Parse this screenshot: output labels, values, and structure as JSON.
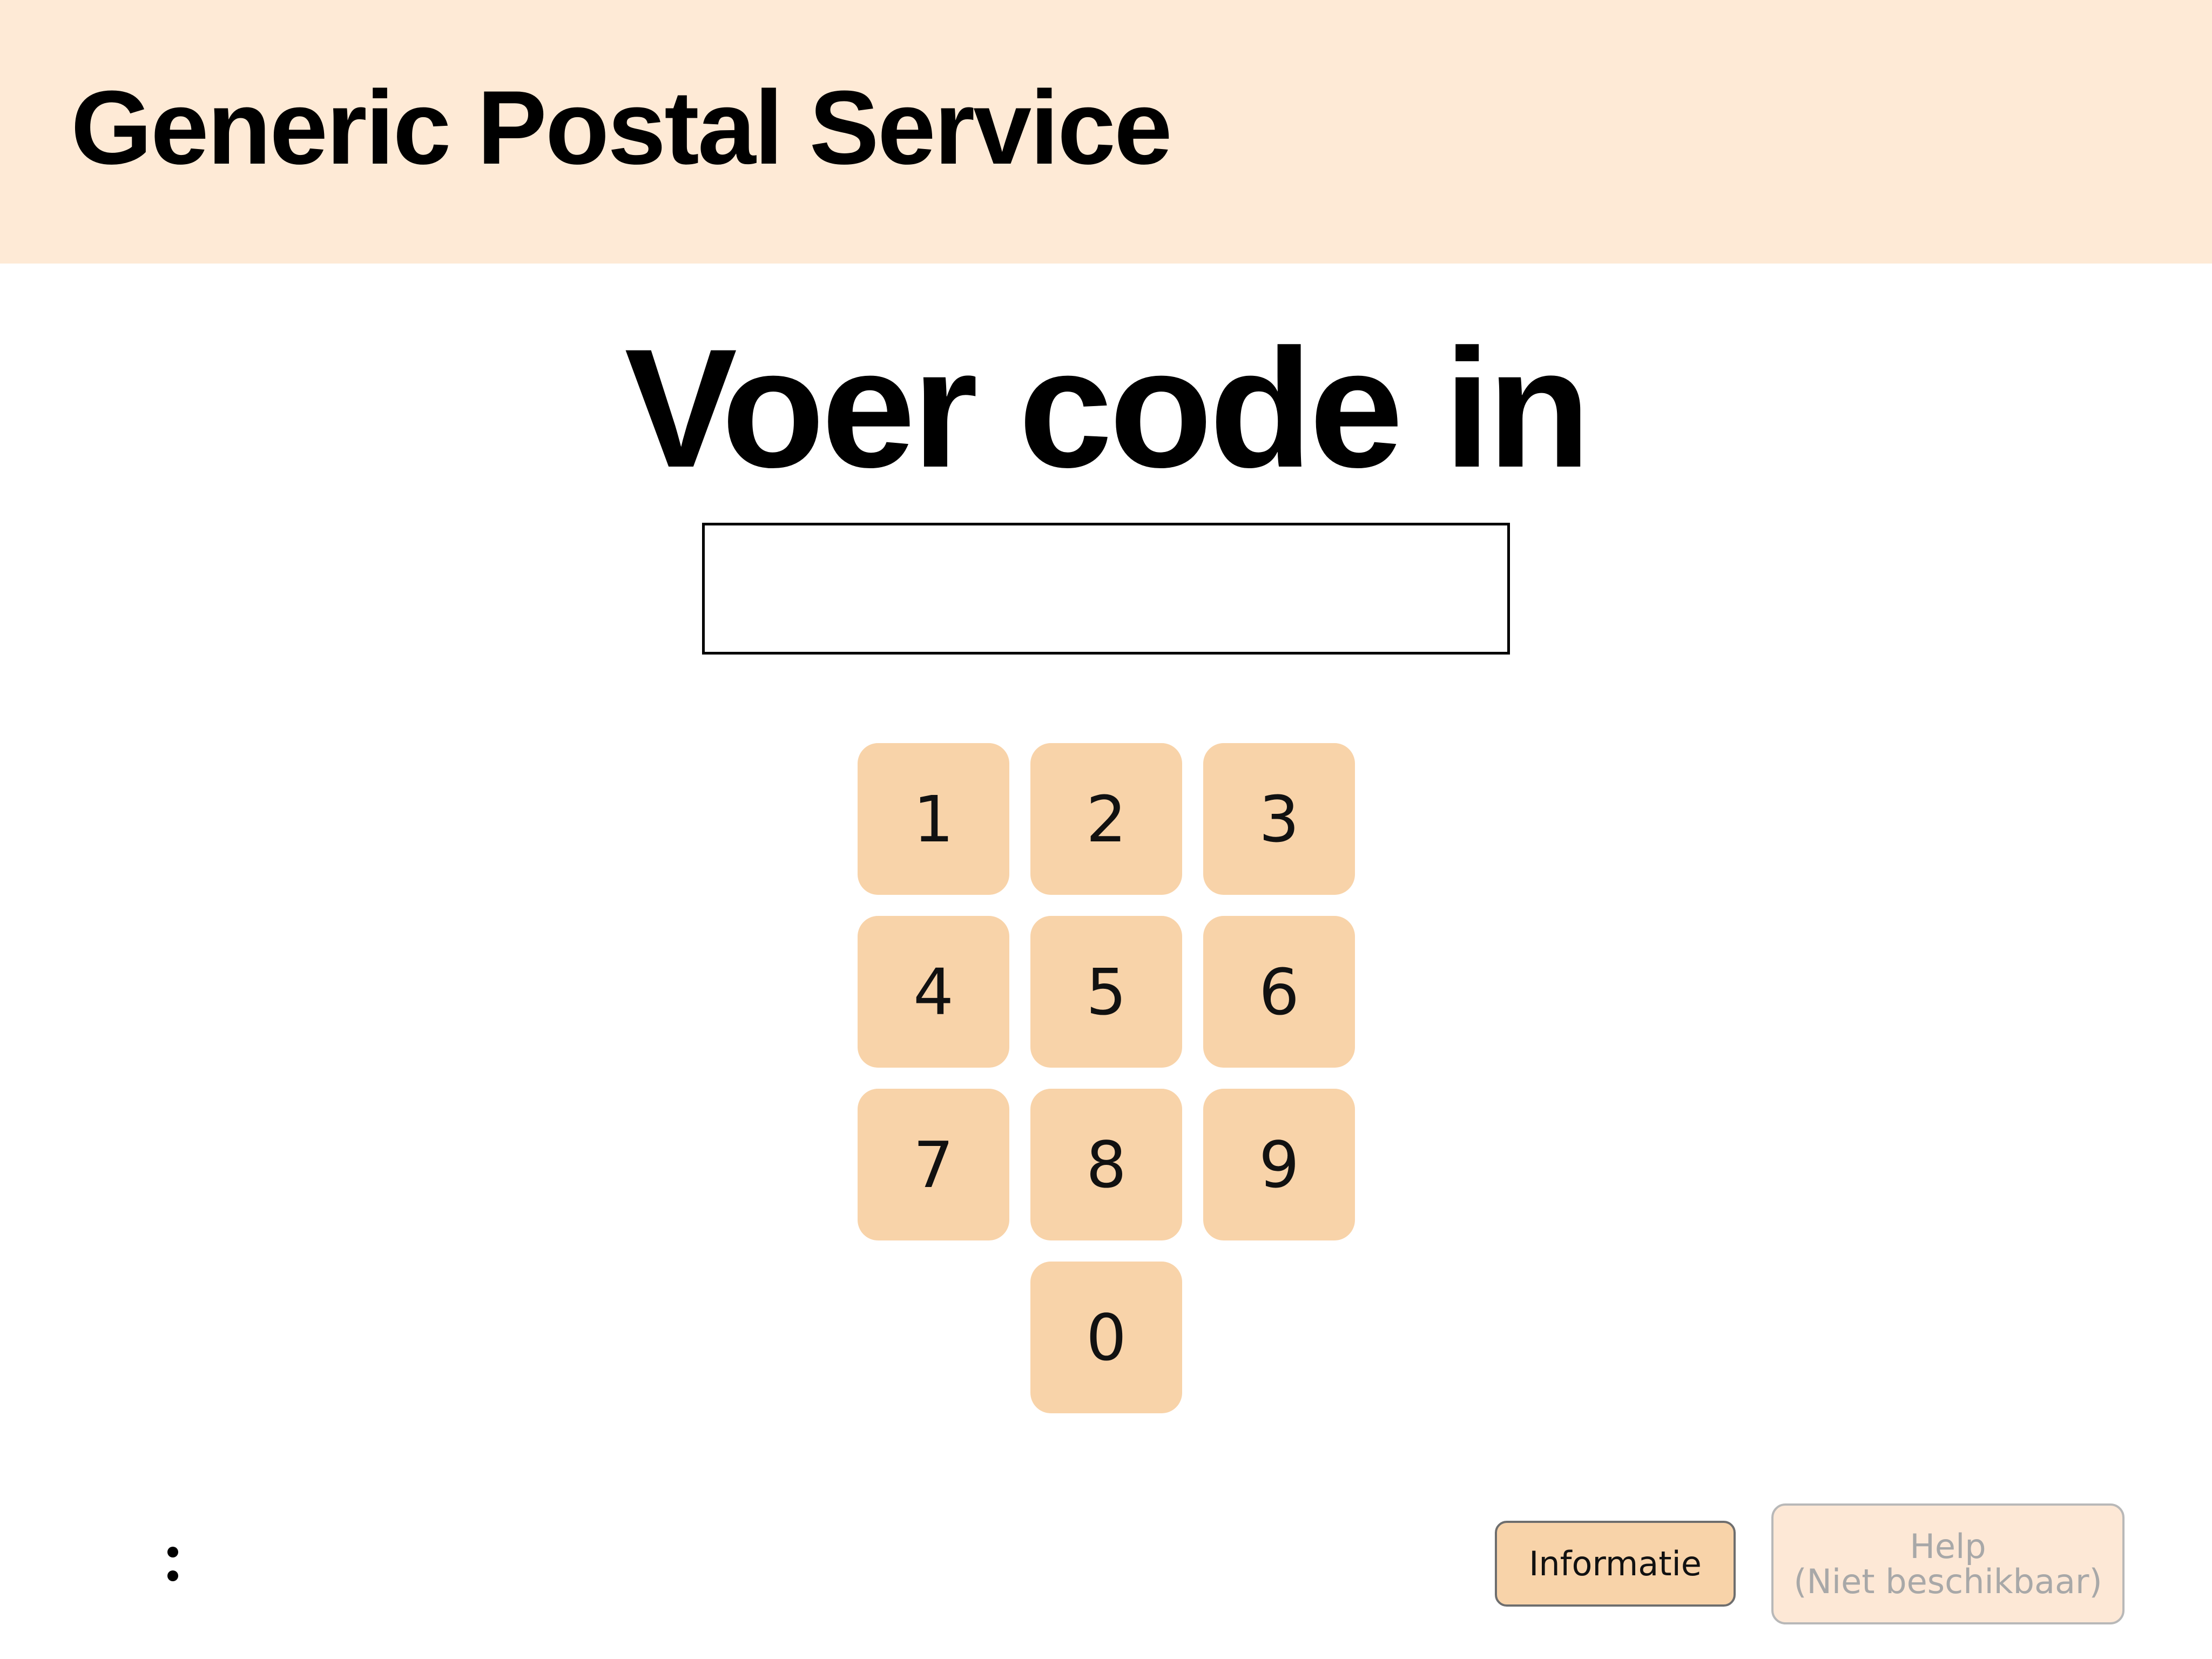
{
  "header": {
    "title": "Generic Postal Service",
    "background_color": "#FEEAD6"
  },
  "main": {
    "title": "Voer code in",
    "code_input": {
      "value": "",
      "placeholder": ""
    }
  },
  "keypad": {
    "key_color": "#F8D3A9",
    "keys": [
      "1",
      "2",
      "3",
      "4",
      "5",
      "6",
      "7",
      "8",
      "9",
      "0"
    ]
  },
  "footer": {
    "menu_icon": "vertical-dots-icon",
    "info_button_label": "Informatie",
    "help_button": {
      "label_line1": "Help",
      "label_line2": "(Niet beschikbaar)",
      "disabled": true
    }
  }
}
